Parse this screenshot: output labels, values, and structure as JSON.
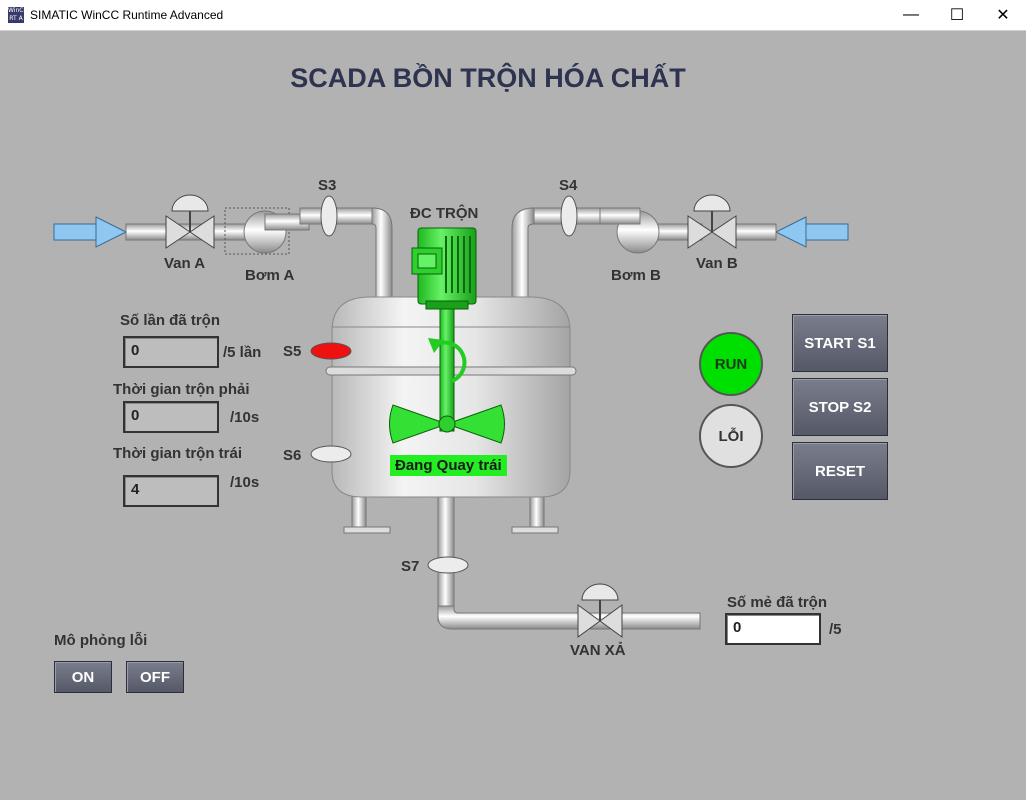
{
  "window": {
    "title": "SIMATIC WinCC Runtime Advanced",
    "icon_text": "WinCC RT A",
    "minimize": "—",
    "maximize": "☐",
    "close": "✕"
  },
  "screen": {
    "title": "SCADA BỒN TRỘN HÓA CHẤT",
    "labels": {
      "s3": "S3",
      "s4": "S4",
      "s5": "S5",
      "s6": "S6",
      "s7": "S7",
      "motor": "ĐC TRỘN",
      "valve_a": "Van A",
      "pump_a": "Bơm A",
      "pump_b": "Bơm B",
      "valve_b": "Van B",
      "drain_valve": "VAN XẢ",
      "motor_status": "Đang Quay trái"
    },
    "counters": {
      "mix_count_label": "Số lần đã trộn",
      "mix_count_value": "0",
      "mix_count_unit": "/5 lần",
      "right_time_label": "Thời gian trộn phải",
      "right_time_value": "0",
      "right_time_unit": "/10s",
      "left_time_label": "Thời gian trộn trái",
      "left_time_value": "4",
      "left_time_unit": "/10s",
      "batch_label": "Số mẻ đã trộn",
      "batch_value": "0",
      "batch_unit": "/5"
    },
    "indicators": {
      "run": "RUN",
      "fault": "LỖI",
      "run_color": "#00e000",
      "fault_color": "#e0e0e0"
    },
    "controls": {
      "start": "START S1",
      "stop": "STOP S2",
      "reset": "RESET"
    },
    "fault_sim": {
      "label": "Mô phỏng lỗi",
      "on": "ON",
      "off": "OFF"
    },
    "colors": {
      "motor_green": "#33e033",
      "sensor_s5_active": "#ee1111",
      "inlet_arrow": "#8ec8f2"
    }
  }
}
